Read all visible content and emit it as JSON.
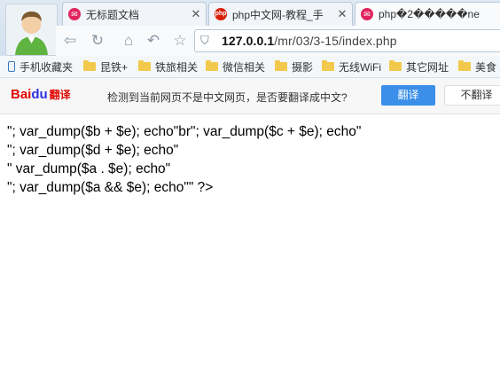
{
  "tabs": [
    {
      "title": "无标题文档",
      "favicon": "pink-app-icon",
      "favicon_text": "✉"
    },
    {
      "title": "php中文网-教程_手",
      "favicon": "php-site-icon",
      "favicon_text": "php"
    },
    {
      "title": "php�2�����ne",
      "favicon": "pink-app-icon",
      "favicon_text": "✉"
    }
  ],
  "address": {
    "host": "127.0.0.1",
    "path": "/mr/03/3-15/index.php"
  },
  "bookmarks": [
    {
      "label": "手机收藏夹",
      "icon": "phone-icon"
    },
    {
      "label": "昆铁+",
      "icon": "folder-icon"
    },
    {
      "label": "铁旅相关",
      "icon": "folder-icon"
    },
    {
      "label": "微信相关",
      "icon": "folder-icon"
    },
    {
      "label": "摄影",
      "icon": "folder-icon"
    },
    {
      "label": "无线WiFi",
      "icon": "folder-icon"
    },
    {
      "label": "其它网址",
      "icon": "folder-icon"
    },
    {
      "label": "美食",
      "icon": "folder-icon"
    }
  ],
  "translate": {
    "logo_bai": "Bai",
    "logo_du": "du",
    "logo_fy": "翻译",
    "message": "检测到当前网页不是中文网页，是否要翻译成中文?",
    "translate_label": "翻译",
    "no_translate_label": "不翻译"
  },
  "content": {
    "lines": [
      "\"; var_dump($b + $e); echo\"br\"; var_dump($c + $e); echo\"",
      "\"; var_dump($d + $e); echo\"",
      "\" var_dump($a . $e); echo\"",
      "\"; var_dump($a && $e); echo\"\" ?>"
    ]
  },
  "colors": {
    "accent": "#3b8fe9",
    "baidu_red": "#e10602",
    "baidu_blue": "#2932e1"
  }
}
